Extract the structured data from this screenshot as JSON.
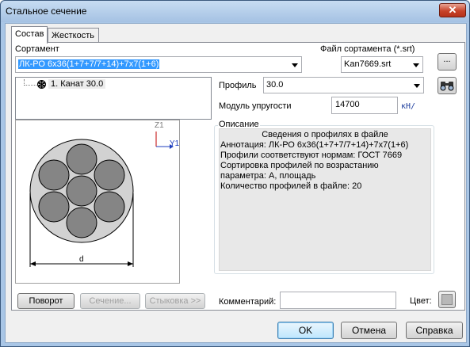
{
  "window": {
    "title": "Стальное сечение",
    "close_glyph": "✕"
  },
  "tabs": [
    {
      "label": "Состав",
      "active": true
    },
    {
      "label": "Жесткость",
      "active": false
    }
  ],
  "sortament": {
    "label": "Сортамент",
    "value": "ЛК-РО 6х36(1+7+7/7+14)+7х7(1+6)"
  },
  "file": {
    "label": "Файл сортамента (*.srt)",
    "value": "Kan7669.srt",
    "browse_label": "..."
  },
  "tree": {
    "items": [
      {
        "label": "1. Канат 30.0",
        "icon": "rope-section-icon"
      }
    ]
  },
  "profile": {
    "label": "Профиль",
    "value": "30.0"
  },
  "modulus": {
    "label": "Модуль упругости",
    "value": "14700",
    "unit": "кН/"
  },
  "description": {
    "group_label": "Описание",
    "heading": "Сведения о профилях в файле",
    "lines": [
      "Аннотация: ЛК-РО 6х36(1+7+7/7+14)+7х7(1+6)",
      "Профили соответствуют нормам: ГОСТ 7669",
      "Сортировка профилей по возрастанию",
      "параметра: А, площадь",
      "Количество профилей в файле: 20"
    ]
  },
  "preview": {
    "axis_z": "Z1",
    "axis_y": "Y1",
    "dimension": "d"
  },
  "buttons": {
    "rotate": "Поворот",
    "section": "Сечение...",
    "assembly": "Стыковка >>",
    "ok": "OK",
    "cancel": "Отмена",
    "help": "Справка"
  },
  "comment": {
    "label": "Комментарий:",
    "value": ""
  },
  "color": {
    "label": "Цвет:"
  }
}
